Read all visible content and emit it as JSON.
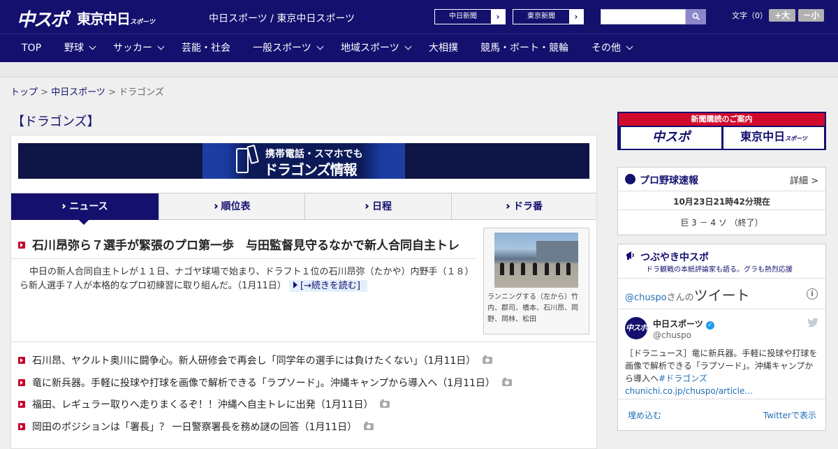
{
  "header": {
    "logo_chuspo": "中スポ",
    "logo_tokyo": "東京中日",
    "logo_tokyo_small": "スポーツ",
    "site_title": "中日スポーツ / 東京中日スポーツ",
    "ext_links": [
      "中日新聞",
      "東京中日スポーツ",
      "東京新聞"
    ],
    "ext_link_1": "中日新聞",
    "ext_link_2": "東京新聞",
    "arrow": "›",
    "search_placeholder": "",
    "font_label": "文字（0）",
    "font_larger": "+大",
    "font_smaller": "－小",
    "colors": {
      "primary": "#14106e",
      "accent": "#c8002a",
      "link": "#1f6fb5"
    }
  },
  "nav": {
    "items": [
      {
        "label": "TOP",
        "dropdown": false
      },
      {
        "label": "野球",
        "dropdown": true
      },
      {
        "label": "サッカー",
        "dropdown": true
      },
      {
        "label": "芸能・社会",
        "dropdown": false
      },
      {
        "label": "一般スポーツ",
        "dropdown": true
      },
      {
        "label": "地域スポーツ",
        "dropdown": true
      },
      {
        "label": "大相撲",
        "dropdown": false
      },
      {
        "label": "競馬・ボート・競輪",
        "dropdown": false
      },
      {
        "label": "その他",
        "dropdown": true
      }
    ]
  },
  "breadcrumb": {
    "top": "トップ",
    "section": "中日スポーツ",
    "current": "ドラゴンズ",
    "sep": " > "
  },
  "page": {
    "title": "【ドラゴンズ】"
  },
  "banner": {
    "line1": "携帯電話・スマホでも",
    "line2": "ドラゴンズ情報"
  },
  "tabs": [
    {
      "label": "ニュース",
      "active": true
    },
    {
      "label": "順位表",
      "active": false
    },
    {
      "label": "日程",
      "active": false
    },
    {
      "label": "ドラ番",
      "active": false
    }
  ],
  "top_story": {
    "headline": "石川昂弥ら７選手が緊張のプロ第一歩　与田監督見守るなかで新人合同自主トレ",
    "lead": "中日の新人合同自主トレが１１日、ナゴヤ球場で始まり、ドラフト１位の石川昂弥（たかや）内野手（１８）ら新人選手７人が本格的なプロ初練習に取り組んだ。（1月11日）",
    "read_more": "[→続きを読む]",
    "photo_caption": "ランニングする（左から）竹内、郡司、橋本、石川昂、岡野、岡林、松田"
  },
  "news": [
    {
      "title": "石川昂、ヤクルト奥川に闘争心。新人研修会で再会し「同学年の選手には負けたくない」（1月11日）",
      "photo": true
    },
    {
      "title": "竜に新兵器。手軽に投球や打球を画像で解析できる「ラプソード」。沖縄キャンプから導入へ（1月11日）",
      "photo": true
    },
    {
      "title": "福田、レギュラー取りへ走りまくるぞ！！沖縄へ自主トレに出発（1月11日）",
      "photo": true
    },
    {
      "title": "岡田のポジションは「署長」？ 一日警察署長を務め謎の回答（1月11日）",
      "photo": true
    }
  ],
  "sidebar": {
    "ad": {
      "top": "新聞購読のご案内",
      "logo1": "中スポ",
      "logo2": "東京中日",
      "logo2_small": "スポーツ"
    },
    "baseball": {
      "title": "プロ野球速報",
      "detail": "詳細 >",
      "updated": "10月23日21時42分現在",
      "score": "巨 3 － 4 ソ （終了）"
    },
    "tweets": {
      "title": "つぶやき中スポ",
      "subtitle": "ドラ観戦の本紙評論家も語る。グラも熱烈応援",
      "handle": "@chuspo",
      "handle_suffix": "さんの",
      "heading": "ツイート",
      "info": "i",
      "avatar_text": "中スポ",
      "account_name": "中日スポーツ",
      "verified": "✓",
      "account_handle": "@chuspo",
      "tweet_text": "［ドラニュース］竜に新兵器。手軽に投球や打球を画像で解析できる「ラプソード」。沖縄キャンプから導入へ",
      "tweet_link": "#ドラゴンズchunichi.co.jp/chuspo/article…",
      "embed": "埋め込む",
      "view_on": "Twitterで表示"
    }
  }
}
